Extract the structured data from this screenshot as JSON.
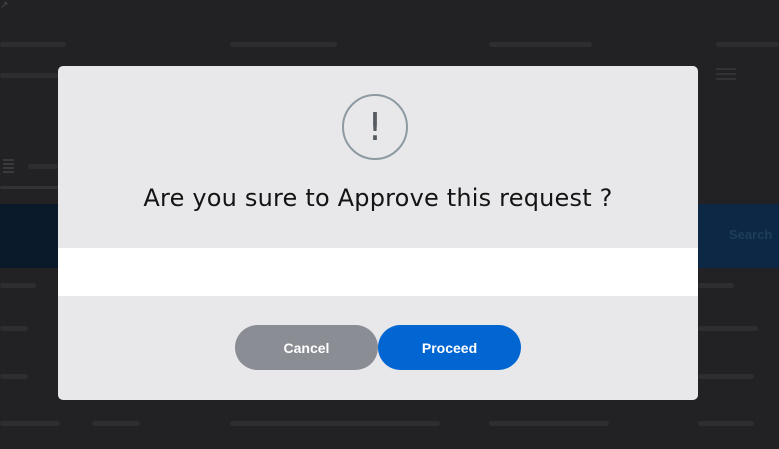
{
  "background": {
    "search_label": "Search"
  },
  "modal": {
    "icon": "exclamation-icon",
    "icon_glyph": "!",
    "title": "Are you sure to Approve this request ?",
    "input_value": "",
    "buttons": {
      "cancel_label": "Cancel",
      "proceed_label": "Proceed"
    }
  },
  "colors": {
    "overlay": "#1f1f21",
    "modal_bg": "#e8e8ea",
    "cancel_button": "#8a8d94",
    "proceed_button": "#0165d2",
    "icon_ring": "#8e9aa1"
  }
}
